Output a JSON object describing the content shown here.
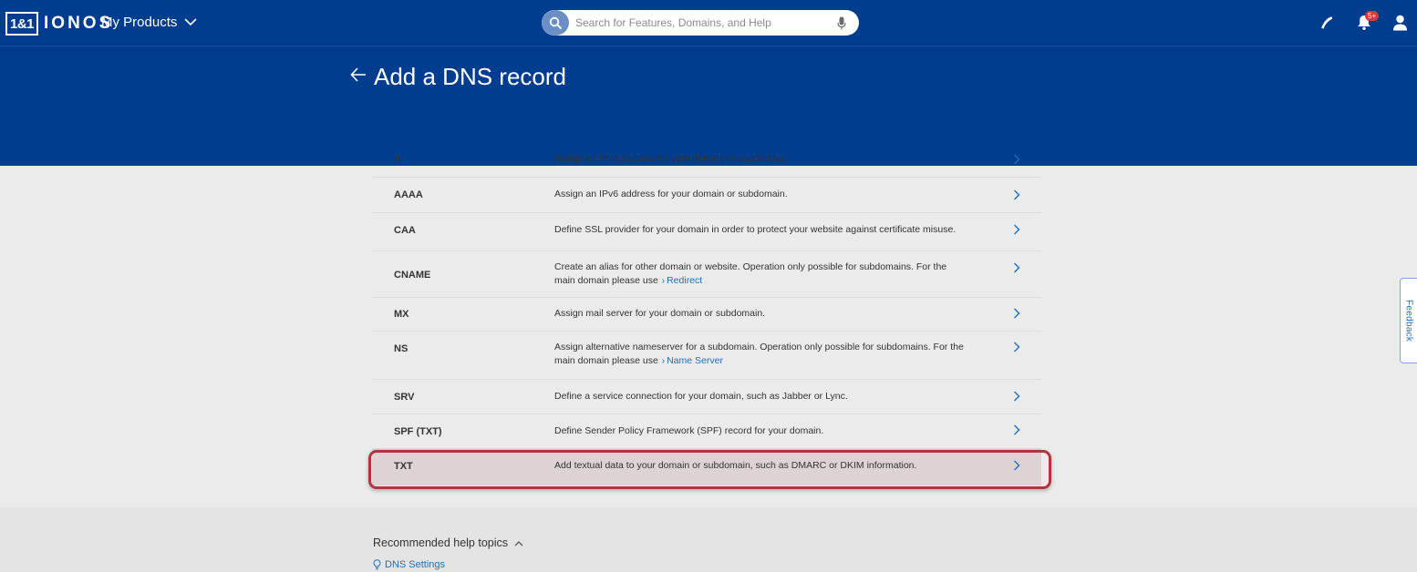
{
  "header": {
    "logo_mark": "1&1",
    "logo_word": "IONOS",
    "products_label": "My Products",
    "search_placeholder": "Search for Features, Domains, and Help",
    "notification_badge": "5+"
  },
  "page": {
    "title": "Add a DNS record"
  },
  "records": [
    {
      "type": "A",
      "description": "Assign an IPv4 address for your domain or subdomain."
    },
    {
      "type": "AAAA",
      "description": "Assign an IPv6 address for your domain or subdomain."
    },
    {
      "type": "CAA",
      "description": "Define SSL provider for your domain in order to protect your website against certificate misuse."
    },
    {
      "type": "CNAME",
      "description": "Create an alias for other domain or website. Operation only possible for subdomains. For the main domain please use",
      "link": "Redirect"
    },
    {
      "type": "MX",
      "description": "Assign mail server for your domain or subdomain."
    },
    {
      "type": "NS",
      "description": "Assign alternative nameserver for a subdomain. Operation only possible for subdomains. For the main domain please use",
      "link": "Name Server"
    },
    {
      "type": "SRV",
      "description": "Define a service connection for your domain, such as Jabber or Lync."
    },
    {
      "type": "SPF (TXT)",
      "description": "Define Sender Policy Framework (SPF) record for your domain."
    },
    {
      "type": "TXT",
      "description": "Add textual data to your domain or subdomain, such as DMARC or DKIM information."
    }
  ],
  "help": {
    "heading": "Recommended help topics",
    "link": "DNS Settings"
  },
  "feedback": {
    "label": "Feedback"
  },
  "colors": {
    "brand_blue": "#003d8f",
    "link_blue": "#1f6fb8",
    "highlight_red": "#b2343d",
    "notification_red": "#d9393b"
  },
  "icons": [
    "search-icon",
    "microphone-icon",
    "phone-icon",
    "bell-icon",
    "user-icon",
    "back-arrow-icon",
    "chevron-right-icon",
    "chevron-down-icon",
    "chevron-up-icon",
    "lightbulb-icon"
  ]
}
